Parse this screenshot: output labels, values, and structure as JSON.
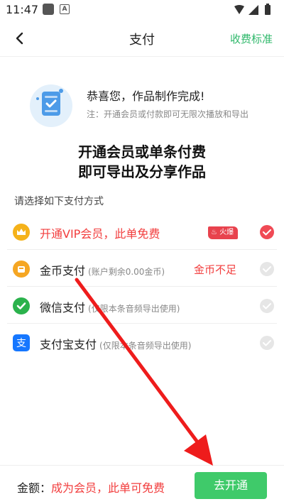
{
  "status_bar": {
    "time": "11:47",
    "app_icon_letter": "A"
  },
  "header": {
    "title": "支付",
    "link": "收费标准"
  },
  "success": {
    "title": "恭喜您，作品制作完成!",
    "note": "注：开通会员或付款即可无限次播放和导出"
  },
  "headline": {
    "line1": "开通会员或单条付费",
    "line2": "即可导出及分享作品"
  },
  "section_label": "请选择如下支付方式",
  "options": [
    {
      "label": "开通VIP会员，此单免费",
      "badge": "火爆",
      "icon": "crown-icon",
      "selected": true,
      "color": "#f23d3d"
    },
    {
      "label": "金币支付",
      "note": "(账户剩余0.00金币)",
      "status": "金币不足",
      "icon": "coin-icon",
      "selected": false
    },
    {
      "label": "微信支付",
      "note": "(仅限本条音频导出使用)",
      "icon": "wechat-icon",
      "selected": false
    },
    {
      "label": "支付宝支付",
      "note": "(仅限本条音频导出使用)",
      "icon": "alipay-icon",
      "selected": false
    }
  ],
  "bottom": {
    "amount_label": "金额：",
    "amount_value": "成为会员，此单可免费",
    "button": "去开通"
  },
  "colors": {
    "accent_green": "#3fca6a",
    "link_green": "#2fb86b",
    "alert_red": "#f23d3d",
    "check_red": "#f04a55"
  }
}
